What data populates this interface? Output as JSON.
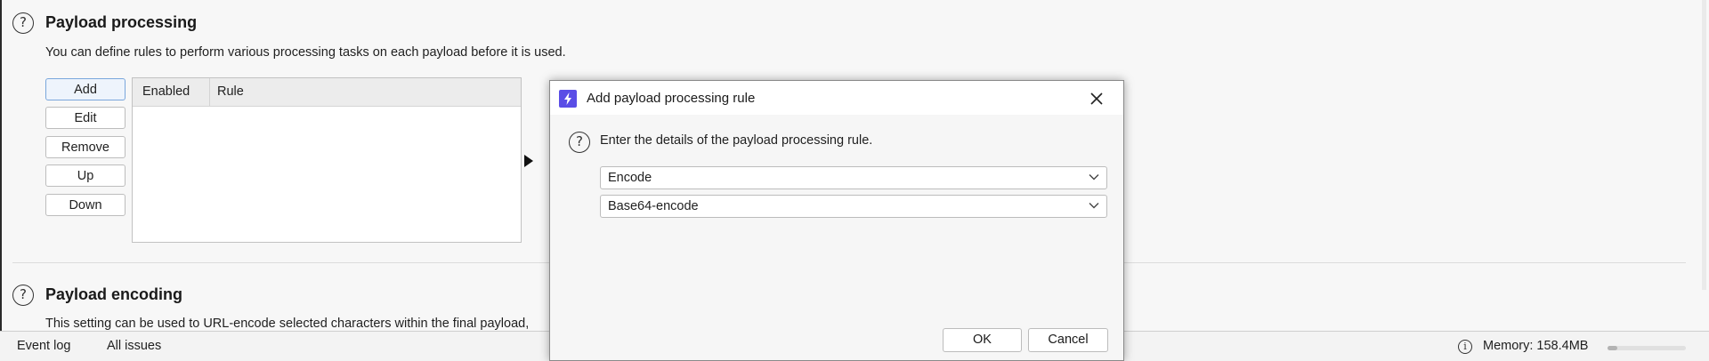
{
  "payload_processing": {
    "title": "Payload processing",
    "description": "You can define rules to perform various processing tasks on each payload before it is used.",
    "buttons": {
      "add": "Add",
      "edit": "Edit",
      "remove": "Remove",
      "up": "Up",
      "down": "Down"
    },
    "table": {
      "columns": [
        "Enabled",
        "Rule"
      ],
      "rows": []
    }
  },
  "payload_encoding": {
    "title": "Payload encoding",
    "description": "This setting can be used to URL-encode selected characters within the final payload,"
  },
  "status_bar": {
    "event_log": "Event log",
    "all_issues": "All issues",
    "memory": "Memory: 158.4MB",
    "memory_fraction": 0.12
  },
  "dialog": {
    "title": "Add payload processing rule",
    "description": "Enter the details of the payload processing rule.",
    "rule_type": "Encode",
    "encoding": "Base64-encode",
    "ok_label": "OK",
    "cancel_label": "Cancel"
  },
  "colors": {
    "accent": "#5a4de6",
    "active_button_border": "#7aa7dc"
  }
}
